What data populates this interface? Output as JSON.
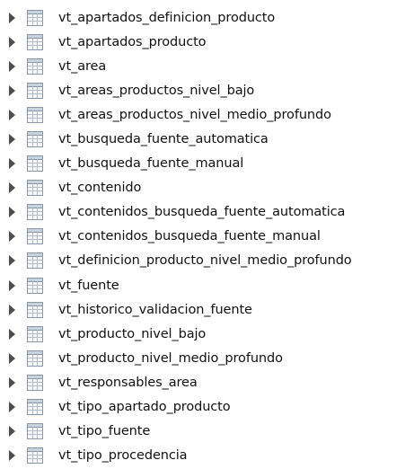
{
  "tree": {
    "icons": {
      "expander": "expand-triangle-icon",
      "item": "table-icon"
    },
    "items": [
      {
        "label": "vt_apartados_definicion_producto"
      },
      {
        "label": "vt_apartados_producto"
      },
      {
        "label": "vt_area"
      },
      {
        "label": "vt_areas_productos_nivel_bajo"
      },
      {
        "label": "vt_areas_productos_nivel_medio_profundo"
      },
      {
        "label": "vt_busqueda_fuente_automatica"
      },
      {
        "label": "vt_busqueda_fuente_manual"
      },
      {
        "label": "vt_contenido"
      },
      {
        "label": "vt_contenidos_busqueda_fuente_automatica"
      },
      {
        "label": "vt_contenidos_busqueda_fuente_manual"
      },
      {
        "label": "vt_definicion_producto_nivel_medio_profundo"
      },
      {
        "label": "vt_fuente"
      },
      {
        "label": "vt_historico_validacion_fuente"
      },
      {
        "label": "vt_producto_nivel_bajo"
      },
      {
        "label": "vt_producto_nivel_medio_profundo"
      },
      {
        "label": "vt_responsables_area"
      },
      {
        "label": "vt_tipo_apartado_producto"
      },
      {
        "label": "vt_tipo_fuente"
      },
      {
        "label": "vt_tipo_procedencia"
      }
    ]
  }
}
